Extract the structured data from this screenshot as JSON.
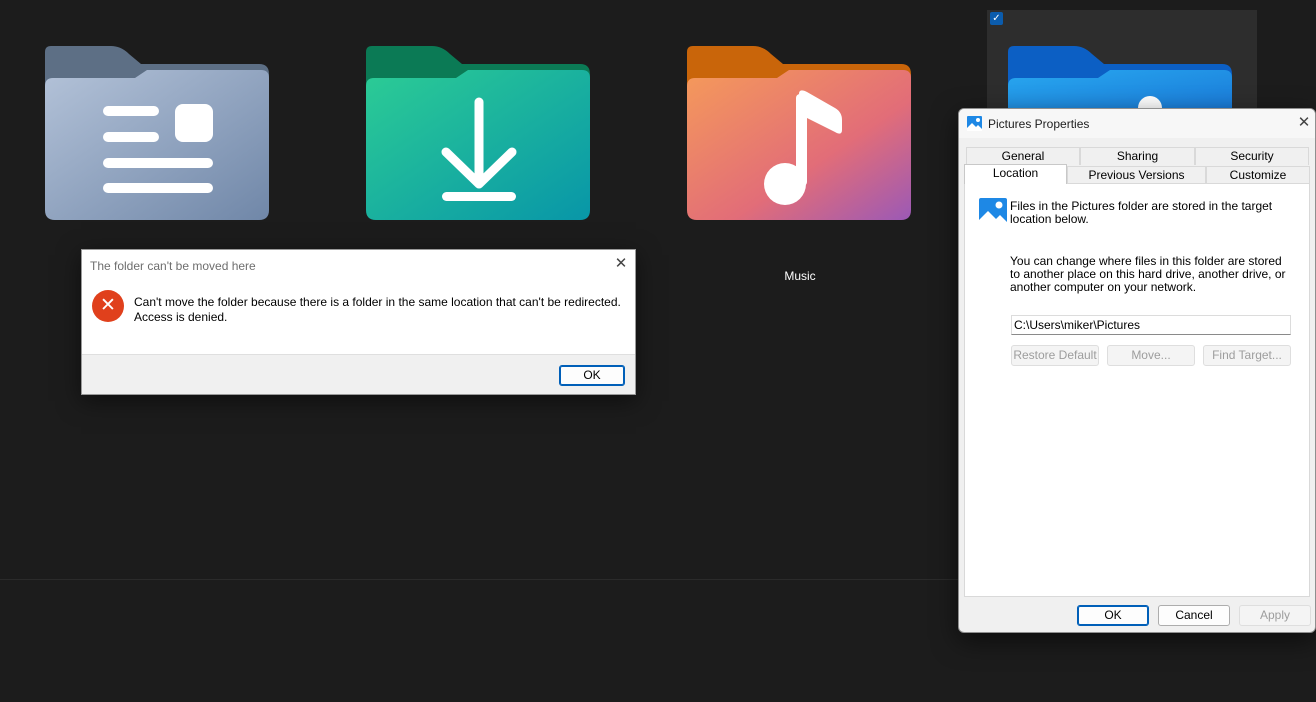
{
  "desktop": {
    "folders": [
      {
        "name": "Documents",
        "label": ""
      },
      {
        "name": "Downloads",
        "label": ""
      },
      {
        "name": "Music",
        "label": "Music"
      }
    ]
  },
  "error_dialog": {
    "title": "The folder can't be moved here",
    "message_line1": "Can't move the folder because there is a folder in the same location that can't be redirected.",
    "message_line2": "Access is denied.",
    "ok_label": "OK",
    "close_glyph": "✕",
    "icon": "error-x-icon"
  },
  "properties": {
    "title": "Pictures Properties",
    "close_glyph": "✕",
    "tabs_row1": [
      "General",
      "Sharing",
      "Security"
    ],
    "tabs_row2": [
      "Location",
      "Previous Versions",
      "Customize"
    ],
    "active_tab": "Location",
    "location": {
      "description": "Files in the Pictures folder are stored in the target location below.",
      "note": "You can change where files in this folder are stored to another place on this hard drive, another drive, or another computer on your network.",
      "path": "C:\\Users\\miker\\Pictures",
      "restore_default_label": "Restore Default",
      "move_label": "Move...",
      "find_target_label": "Find Target..."
    },
    "footer": {
      "ok_label": "OK",
      "cancel_label": "Cancel",
      "apply_label": "Apply"
    }
  },
  "colors": {
    "desktop_bg": "#1c1c1c",
    "accent": "#005fb8",
    "error_red": "#e0401c"
  }
}
